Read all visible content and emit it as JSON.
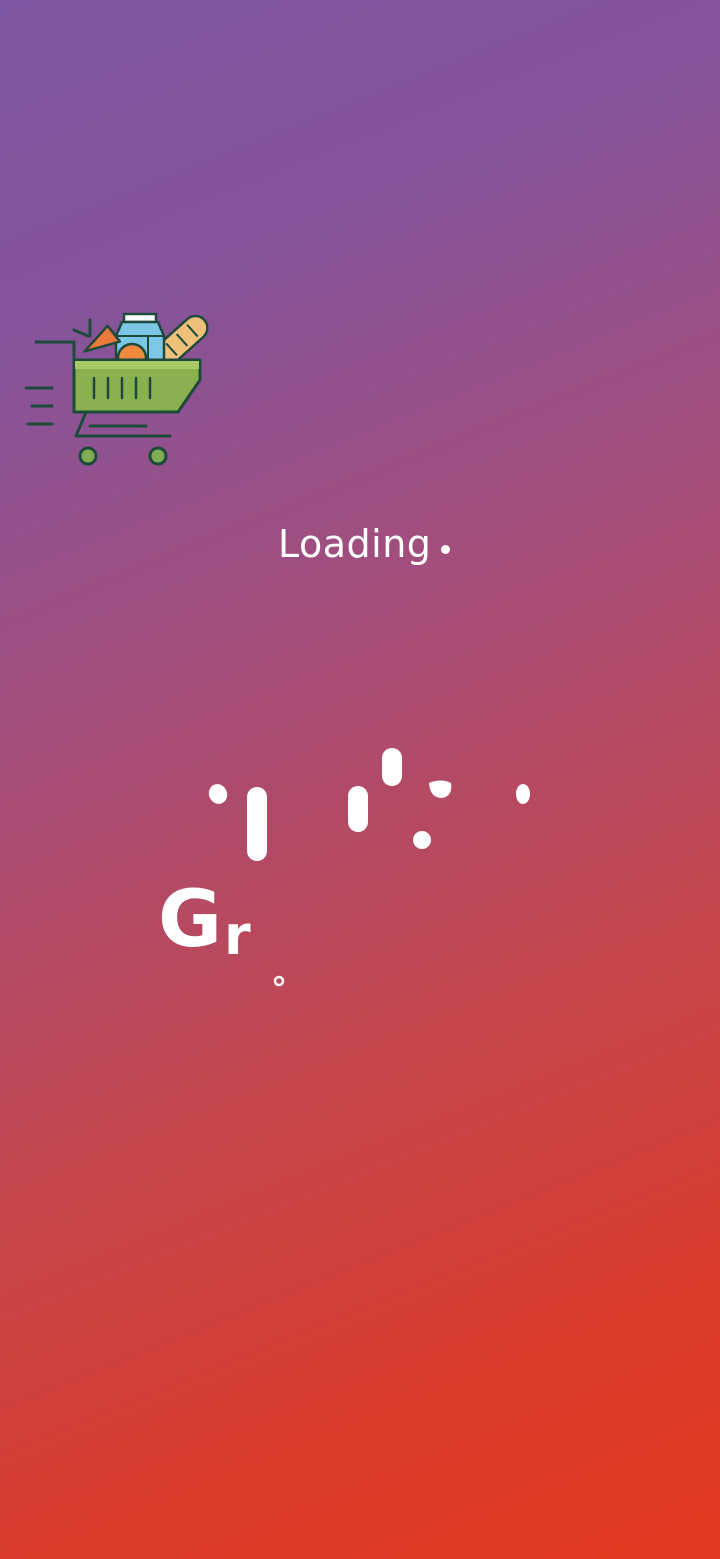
{
  "splash": {
    "loading_text": "Loading",
    "brand_partial": {
      "letter_g": "G",
      "letter_r": "r"
    },
    "icons": {
      "cart": "shopping-cart-groceries-icon",
      "dot": "loading-dot-icon"
    },
    "colors": {
      "gradient_start": "#7f56a1",
      "gradient_mid": "#b04a63",
      "gradient_end": "#e43a1f",
      "text": "#ffffff",
      "cart_basket": "#8bb04f",
      "cart_outline": "#1d4a3a",
      "milk": "#7cc6e6",
      "carrot": "#ec7a3a",
      "bread": "#efc07a"
    }
  }
}
